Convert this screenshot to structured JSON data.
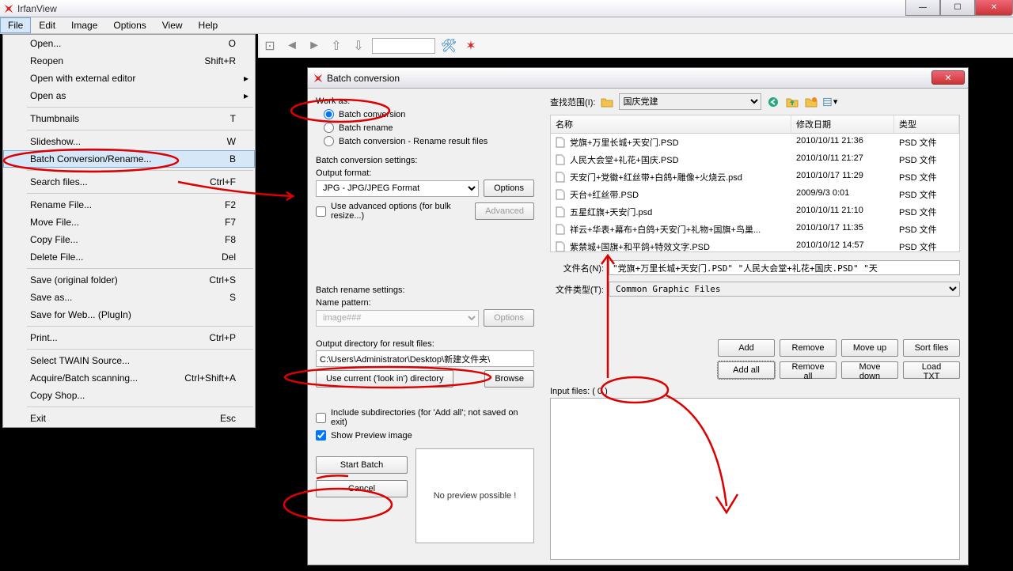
{
  "app": {
    "title": "IrfanView"
  },
  "menubar": [
    "File",
    "Edit",
    "Image",
    "Options",
    "View",
    "Help"
  ],
  "fileMenu": {
    "items": [
      {
        "label": "Open...",
        "accel": "O"
      },
      {
        "label": "Reopen",
        "accel": "Shift+R"
      },
      {
        "label": "Open with external editor",
        "arrow": true
      },
      {
        "label": "Open as",
        "arrow": true
      },
      {
        "sep": true
      },
      {
        "label": "Thumbnails",
        "accel": "T"
      },
      {
        "sep": true
      },
      {
        "label": "Slideshow...",
        "accel": "W"
      },
      {
        "label": "Batch Conversion/Rename...",
        "accel": "B",
        "hl": true
      },
      {
        "sep": true
      },
      {
        "label": "Search files...",
        "accel": "Ctrl+F"
      },
      {
        "sep": true
      },
      {
        "label": "Rename File...",
        "accel": "F2"
      },
      {
        "label": "Move File...",
        "accel": "F7"
      },
      {
        "label": "Copy File...",
        "accel": "F8"
      },
      {
        "label": "Delete File...",
        "accel": "Del"
      },
      {
        "sep": true
      },
      {
        "label": "Save (original folder)",
        "accel": "Ctrl+S"
      },
      {
        "label": "Save as...",
        "accel": "S"
      },
      {
        "label": "Save for Web... (PlugIn)"
      },
      {
        "sep": true
      },
      {
        "label": "Print...",
        "accel": "Ctrl+P"
      },
      {
        "sep": true
      },
      {
        "label": "Select TWAIN Source..."
      },
      {
        "label": "Acquire/Batch scanning...",
        "accel": "Ctrl+Shift+A"
      },
      {
        "label": "Copy Shop..."
      },
      {
        "sep": true
      },
      {
        "label": "Exit",
        "accel": "Esc"
      }
    ]
  },
  "dialog": {
    "title": "Batch conversion",
    "workAs": "Work as:",
    "radios": [
      "Batch conversion",
      "Batch rename",
      "Batch conversion - Rename result files"
    ],
    "bcSettings": "Batch conversion settings:",
    "outputFormat": "Output format:",
    "formatValue": "JPG - JPG/JPEG Format",
    "optionsBtn": "Options",
    "advCheck": "Use advanced options (for bulk resize...)",
    "advBtn": "Advanced",
    "brSettings": "Batch rename settings:",
    "namePattern": "Name pattern:",
    "namePatternValue": "image###",
    "outputDir": "Output directory for result files:",
    "outputDirValue": "C:\\Users\\Administrator\\Desktop\\新建文件夹\\",
    "useCurrentBtn": "Use current ('look in') directory",
    "browseBtn": "Browse",
    "includeSub": "Include subdirectories (for 'Add all'; not saved on exit)",
    "showPreview": "Show Preview image",
    "startBtn": "Start Batch",
    "cancelBtn": "Cancel",
    "previewText": "No preview possible !",
    "lookIn": "查找范围(I):",
    "lookInValue": "国庆党建",
    "table": {
      "cols": [
        "名称",
        "修改日期",
        "类型"
      ],
      "rows": [
        {
          "name": "党旗+万里长城+天安门.PSD",
          "date": "2010/10/11 21:36",
          "type": "PSD 文件"
        },
        {
          "name": "人民大会堂+礼花+国庆.PSD",
          "date": "2010/10/11 21:27",
          "type": "PSD 文件"
        },
        {
          "name": "天安门+党徽+红丝带+白鸽+雕像+火烧云.psd",
          "date": "2010/10/17 11:29",
          "type": "PSD 文件"
        },
        {
          "name": "天台+红丝带.PSD",
          "date": "2009/9/3 0:01",
          "type": "PSD 文件"
        },
        {
          "name": "五星红旗+天安门.psd",
          "date": "2010/10/11 21:10",
          "type": "PSD 文件"
        },
        {
          "name": "祥云+华表+幕布+白鸽+天安门+礼物+国旗+鸟巢...",
          "date": "2010/10/17 11:35",
          "type": "PSD 文件"
        },
        {
          "name": "紫禁城+国旗+和平鸽+特效文字.PSD",
          "date": "2010/10/12 14:57",
          "type": "PSD 文件"
        }
      ]
    },
    "fileNameLabel": "文件名(N):",
    "fileNameValue": "\"党旗+万里长城+天安门.PSD\" \"人民大会堂+礼花+国庆.PSD\" \"天",
    "fileTypeLabel": "文件类型(T):",
    "fileTypeValue": "Common Graphic Files",
    "btns1": [
      "Add",
      "Remove",
      "Move up",
      "Sort files"
    ],
    "btns2": [
      "Add all",
      "Remove all",
      "Move down",
      "Load TXT"
    ],
    "inputFilesLabel": "Input files: ( 0 )"
  }
}
